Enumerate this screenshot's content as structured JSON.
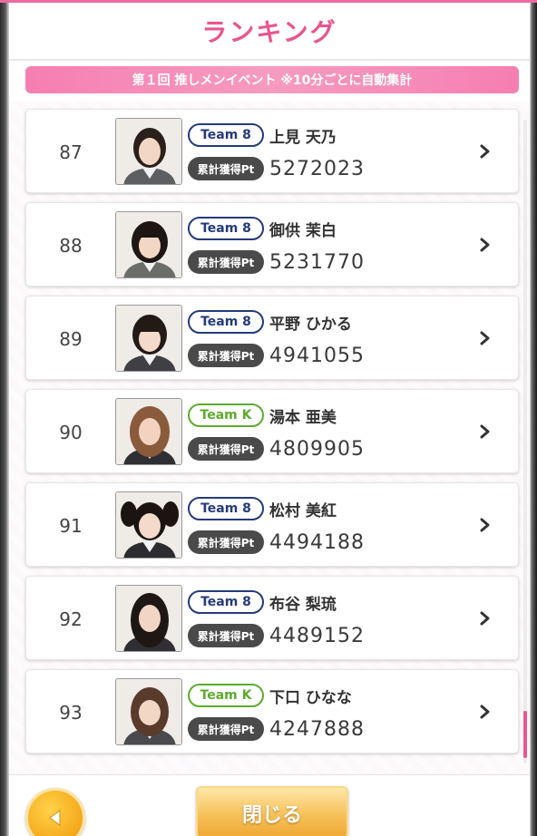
{
  "header": {
    "title": "ランキング"
  },
  "event_banner": "第１回 推しメンイベント ※10分ごとに自動集計",
  "pt_label": "累計獲得Pt",
  "rows": [
    {
      "rank": "87",
      "team": "Team 8",
      "team_color": "#253a7a",
      "name": "上見 天乃",
      "points": "5272023"
    },
    {
      "rank": "88",
      "team": "Team 8",
      "team_color": "#253a7a",
      "name": "御供 茉白",
      "points": "5231770"
    },
    {
      "rank": "89",
      "team": "Team 8",
      "team_color": "#253a7a",
      "name": "平野 ひかる",
      "points": "4941055"
    },
    {
      "rank": "90",
      "team": "Team K",
      "team_color": "#5dab2c",
      "name": "湯本 亜美",
      "points": "4809905"
    },
    {
      "rank": "91",
      "team": "Team 8",
      "team_color": "#253a7a",
      "name": "松村 美紅",
      "points": "4494188"
    },
    {
      "rank": "92",
      "team": "Team 8",
      "team_color": "#253a7a",
      "name": "布谷 梨琉",
      "points": "4489152"
    },
    {
      "rank": "93",
      "team": "Team K",
      "team_color": "#5dab2c",
      "name": "下口 ひなな",
      "points": "4247888"
    }
  ],
  "footer": {
    "close_label": "閉じる",
    "back_icon": "triangle-left-icon"
  },
  "colors": {
    "accent": "#e8568f",
    "banner": "#f57fb0",
    "team8": "#253a7a",
    "teamK": "#5dab2c",
    "button": "#f6c159"
  }
}
